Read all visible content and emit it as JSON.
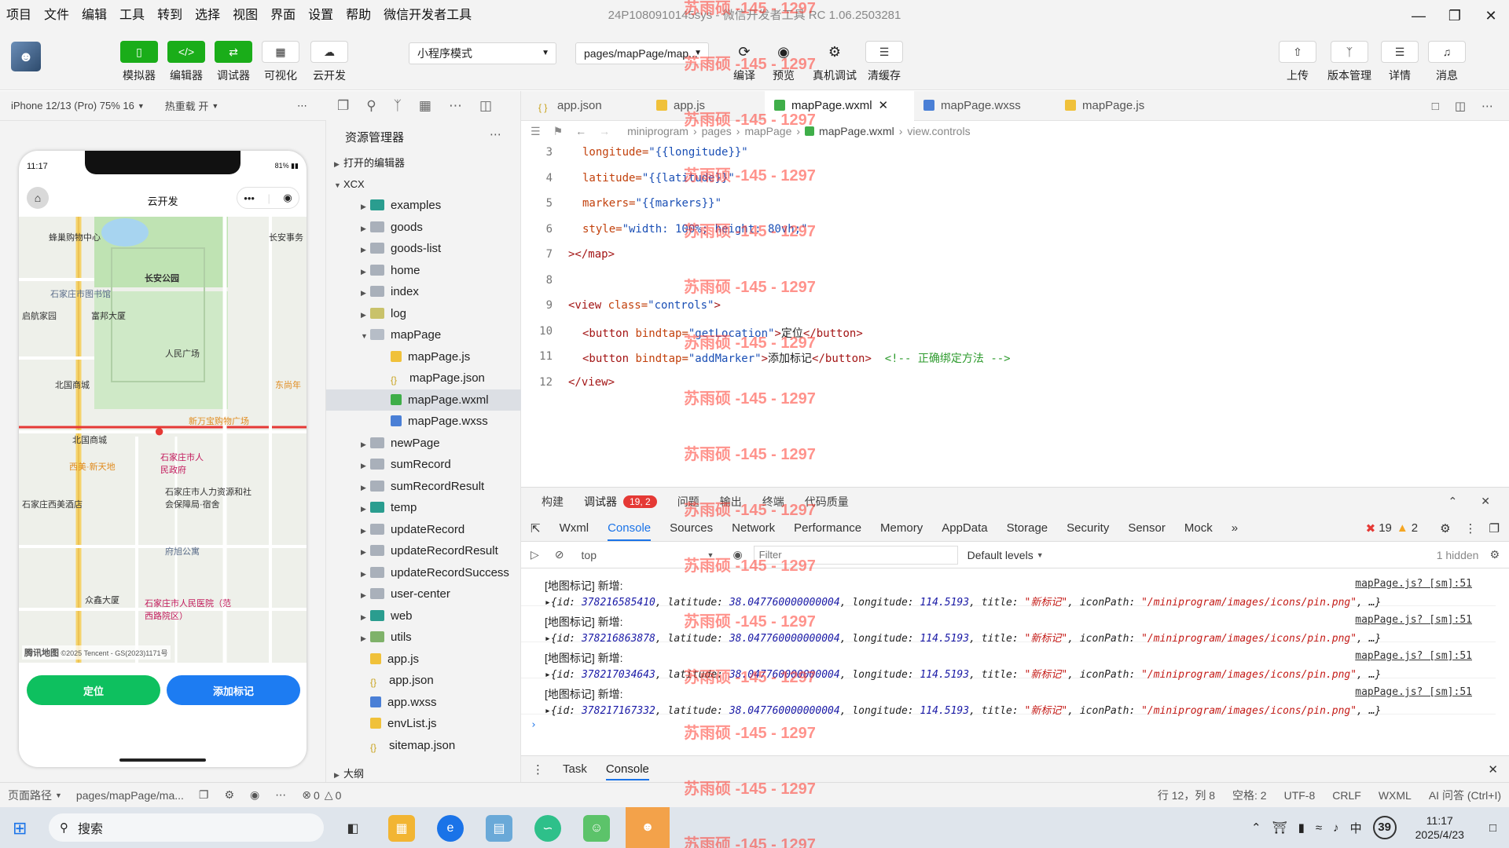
{
  "menu": [
    "项目",
    "文件",
    "编辑",
    "工具",
    "转到",
    "选择",
    "视图",
    "界面",
    "设置",
    "帮助",
    "微信开发者工具"
  ],
  "window_title": "24P1080910145sys - 微信开发者工具 RC 1.06.2503281",
  "toolbar": {
    "simulator": "模拟器",
    "editor": "编辑器",
    "debugger": "调试器",
    "visual": "可视化",
    "cloud": "云开发",
    "mode_select": "小程序模式",
    "page_select": "pages/mapPage/map...",
    "compile": "编译",
    "preview": "预览",
    "remote_debug": "真机调试",
    "clear_cache": "清缓存",
    "upload": "上传",
    "version": "版本管理",
    "details": "详情",
    "messages": "消息"
  },
  "sim_bar": {
    "device": "iPhone 12/13 (Pro) 75% 16",
    "hot_reload": "热重载 开"
  },
  "phone": {
    "time": "11:17",
    "battery": "81%",
    "title": "云开发",
    "btn_locate": "定位",
    "btn_add": "添加标记",
    "map_labels": [
      "蜂巢购物中心",
      "长安公园",
      "石家庄市图书馆",
      "启航家园",
      "富邦大厦",
      "人民广场",
      "北国商城",
      "北国商城",
      "新万宝购物广场",
      "石家庄市人民政府",
      "石家庄市人力资源和社会保障局·宿舍",
      "府旭公寓",
      "石家庄西美酒店",
      "众鑫大厦",
      "石家庄市人民医院（范西路院区）",
      "长安事务",
      "东尚年",
      "西美·新天地"
    ],
    "map_credit": "©2025 Tencent - GS(2023)1171号",
    "map_logo": "腾讯地图"
  },
  "explorer": {
    "title": "资源管理器",
    "open_editors": "打开的编辑器",
    "root": "XCX",
    "items": [
      "examples",
      "goods",
      "goods-list",
      "home",
      "index",
      "log",
      "mapPage",
      "mapPage.js",
      "mapPage.json",
      "mapPage.wxml",
      "mapPage.wxss",
      "newPage",
      "sumRecord",
      "sumRecordResult",
      "temp",
      "updateRecord",
      "updateRecordResult",
      "updateRecordSuccess",
      "user-center",
      "web",
      "utils",
      "app.js",
      "app.json",
      "app.wxss",
      "envList.js",
      "sitemap.json"
    ],
    "outline": "大纲"
  },
  "editor": {
    "tabs": [
      "app.json",
      "app.js",
      "mapPage.wxml",
      "mapPage.wxss",
      "mapPage.js"
    ],
    "breadcrumb": [
      "miniprogram",
      "pages",
      "mapPage",
      "mapPage.wxml",
      "view.controls"
    ],
    "lines": [
      {
        "n": "3",
        "parts": [
          [
            "attr",
            "longitude="
          ],
          [
            "str",
            "\"{{longitude}}\""
          ]
        ]
      },
      {
        "n": "4",
        "parts": [
          [
            "attr",
            "latitude="
          ],
          [
            "str",
            "\"{{latitude}}\""
          ]
        ]
      },
      {
        "n": "5",
        "parts": [
          [
            "attr",
            "markers="
          ],
          [
            "str",
            "\"{{markers}}\""
          ]
        ]
      },
      {
        "n": "6",
        "parts": [
          [
            "attr",
            "style="
          ],
          [
            "str",
            "\"width: 100%; height: 80vh;\""
          ]
        ]
      },
      {
        "n": "7",
        "parts": [
          [
            "tag",
            "></map>"
          ]
        ]
      },
      {
        "n": "8",
        "parts": []
      },
      {
        "n": "9",
        "parts": [
          [
            "tag",
            "<view "
          ],
          [
            "attr",
            "class="
          ],
          [
            "str",
            "\"controls\""
          ],
          [
            "tag",
            ">"
          ]
        ]
      },
      {
        "n": "10",
        "parts": [
          [
            "tag",
            "<button "
          ],
          [
            "attr",
            "bindtap="
          ],
          [
            "str",
            "\"getLocation\""
          ],
          [
            "tag",
            ">"
          ],
          [
            "plain",
            "定位"
          ],
          [
            "tag",
            "</button>"
          ]
        ]
      },
      {
        "n": "11",
        "parts": [
          [
            "tag",
            "<button "
          ],
          [
            "attr",
            "bindtap="
          ],
          [
            "str",
            "\"addMarker\""
          ],
          [
            "tag",
            ">"
          ],
          [
            "plain",
            "添加标记"
          ],
          [
            "tag",
            "</button>"
          ],
          [
            "cmt",
            "  <!-- 正确绑定方法 -->"
          ]
        ]
      },
      {
        "n": "12",
        "parts": [
          [
            "tag",
            "</view>"
          ]
        ]
      }
    ]
  },
  "devtools": {
    "header_tabs": [
      "构建",
      "调试器",
      "问题",
      "输出",
      "终端",
      "代码质量"
    ],
    "debug_badge": "19, 2",
    "tabs": [
      "Wxml",
      "Console",
      "Sources",
      "Network",
      "Performance",
      "Memory",
      "AppData",
      "Storage",
      "Security",
      "Sensor",
      "Mock"
    ],
    "errors": "19",
    "warnings": "2",
    "context": "top",
    "filter_placeholder": "Filter",
    "levels": "Default levels",
    "hidden": "1 hidden",
    "logs": [
      {
        "label": "[地图标记] 新增:",
        "id": "378216585410",
        "lat": "38.047760000000004",
        "lng": "114.5193",
        "title": "\"新标记\"",
        "icon": "\"/miniprogram/images/icons/pin.png\"",
        "src": "mapPage.js? [sm]:51"
      },
      {
        "label": "[地图标记] 新增:",
        "id": "378216863878",
        "lat": "38.047760000000004",
        "lng": "114.5193",
        "title": "\"新标记\"",
        "icon": "\"/miniprogram/images/icons/pin.png\"",
        "src": "mapPage.js? [sm]:51"
      },
      {
        "label": "[地图标记] 新增:",
        "id": "378217034643",
        "lat": "38.047760000000004",
        "lng": "114.5193",
        "title": "\"新标记\"",
        "icon": "\"/miniprogram/images/icons/pin.png\"",
        "src": "mapPage.js? [sm]:51"
      },
      {
        "label": "[地图标记] 新增:",
        "id": "378217167332",
        "lat": "38.047760000000004",
        "lng": "114.5193",
        "title": "\"新标记\"",
        "icon": "\"/miniprogram/images/icons/pin.png\"",
        "src": "mapPage.js? [sm]:51"
      }
    ],
    "bottom_tabs": [
      "Task",
      "Console"
    ]
  },
  "statusbar": {
    "page_path_label": "页面路径",
    "page_path": "pages/mapPage/ma...",
    "errors": "0",
    "warnings": "0",
    "cursor": "行 12，列 8",
    "spaces": "空格: 2",
    "encoding": "UTF-8",
    "eol": "CRLF",
    "lang": "WXML",
    "ai": "AI 问答 (Ctrl+I)"
  },
  "taskbar": {
    "search": "搜索",
    "time": "11:17",
    "date": "2025/4/23",
    "ime": "中",
    "badge": "39"
  },
  "watermark": "苏雨硕 -145 - 1297",
  "colors": {
    "accent_green": "#1aad19",
    "btn_green": "#0ec05f",
    "btn_blue": "#1d7cf2"
  }
}
